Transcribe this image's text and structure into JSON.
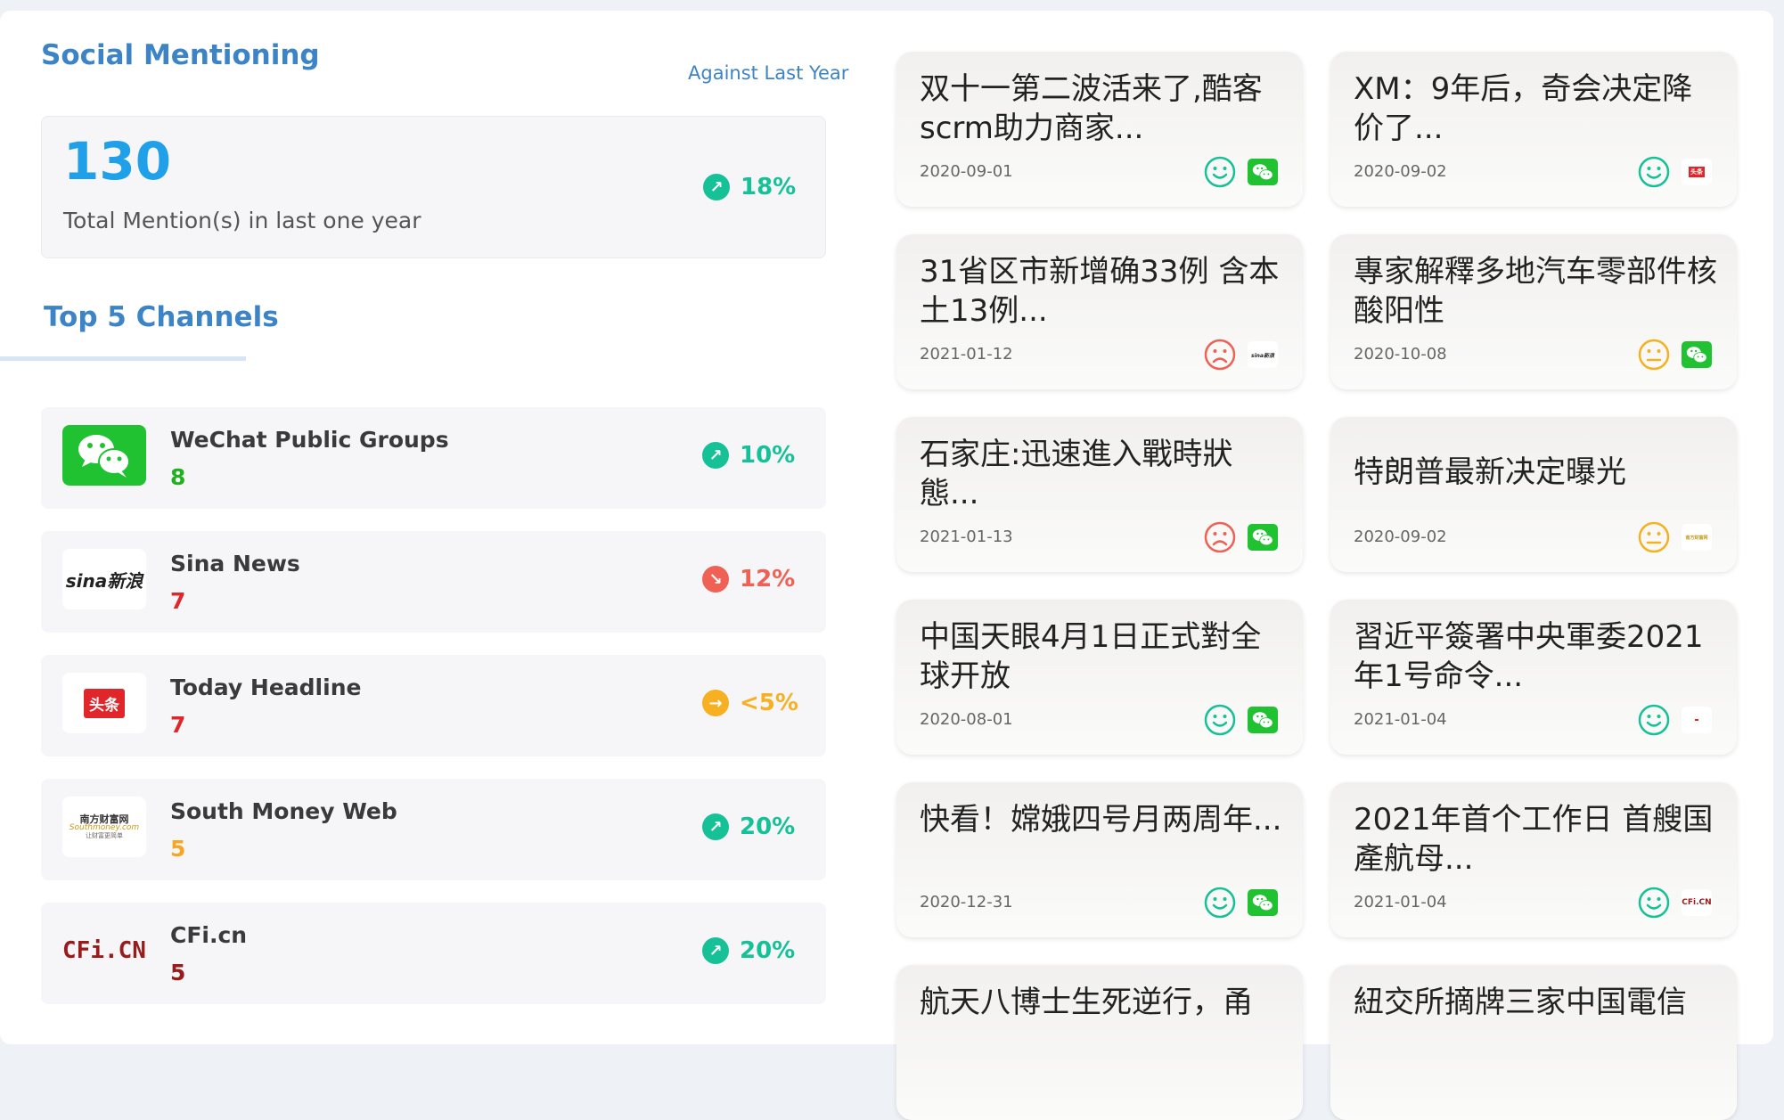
{
  "header": {
    "title": "Social Mentioning",
    "compare_label": "Against Last Year"
  },
  "summary": {
    "total": "130",
    "label": "Total Mention(s) in last one year",
    "change": "18%",
    "direction": "up"
  },
  "channels_title": "Top 5 Channels",
  "channels": [
    {
      "name": "WeChat Public Groups",
      "count": "8",
      "change": "10%",
      "direction": "up",
      "count_color": "#20b020",
      "logo": "wechat-logo"
    },
    {
      "name": "Sina News",
      "count": "7",
      "change": "12%",
      "direction": "down",
      "count_color": "#e0262a",
      "logo": "sina-logo"
    },
    {
      "name": "Today Headline",
      "count": "7",
      "change": "<5%",
      "direction": "flat",
      "count_color": "#e0262a",
      "logo": "toutiao-logo"
    },
    {
      "name": "South Money Web",
      "count": "5",
      "change": "20%",
      "direction": "up",
      "count_color": "#f5a623",
      "logo": "southmoney-logo"
    },
    {
      "name": "CFi.cn",
      "count": "5",
      "change": "20%",
      "direction": "up",
      "count_color": "#9a1b1b",
      "logo": "cfi-logo"
    }
  ],
  "logo_text": {
    "sina": "sina新浪",
    "toutiao": "头条",
    "southmoney_cn": "南方财富网",
    "southmoney_en": "Southmoney.com",
    "southmoney_sub": "让财富更简单",
    "cfi": "CFi.CN"
  },
  "news": [
    {
      "title": "双十一第二波活来了,酷客scrm助力商家...",
      "date": "2020-09-01",
      "sentiment": "positive",
      "source": "wechat"
    },
    {
      "title": "XM：9年后，奇会决定降价了...",
      "date": "2020-09-02",
      "sentiment": "positive",
      "source": "toutiao"
    },
    {
      "title": "31省区市新增确33例 含本土13例...",
      "date": "2021-01-12",
      "sentiment": "negative",
      "source": "sina"
    },
    {
      "title": "專家解釋多地汽车零部件核酸阳性",
      "date": "2020-10-08",
      "sentiment": "neutral",
      "source": "wechat"
    },
    {
      "title": "石家庄:迅速進入戰時狀態...",
      "date": "2021-01-13",
      "sentiment": "negative",
      "source": "wechat"
    },
    {
      "title": "特朗普最新决定曝光",
      "date": "2020-09-02",
      "sentiment": "neutral",
      "source": "southmoney"
    },
    {
      "title": "中国天眼4月1日正式對全球开放",
      "date": "2020-08-01",
      "sentiment": "positive",
      "source": "wechat"
    },
    {
      "title": "習近平簽署中央軍委2021年1号命令...",
      "date": "2021-01-04",
      "sentiment": "positive",
      "source": "other"
    },
    {
      "title": "快看！嫦娥四号月两周年...",
      "date": "2020-12-31",
      "sentiment": "positive",
      "source": "wechat"
    },
    {
      "title": "2021年首个工作日 首艘国產航母...",
      "date": "2021-01-04",
      "sentiment": "positive",
      "source": "cfi"
    },
    {
      "title": "航天八博士生死逆行，甬",
      "date": "",
      "sentiment": "",
      "source": ""
    },
    {
      "title": "紐交所摘牌三家中国電信",
      "date": "",
      "sentiment": "",
      "source": ""
    }
  ],
  "colors": {
    "accent": "#3d84c6",
    "positive": "#16c197",
    "negative": "#ee6154",
    "neutral": "#f6b021"
  }
}
